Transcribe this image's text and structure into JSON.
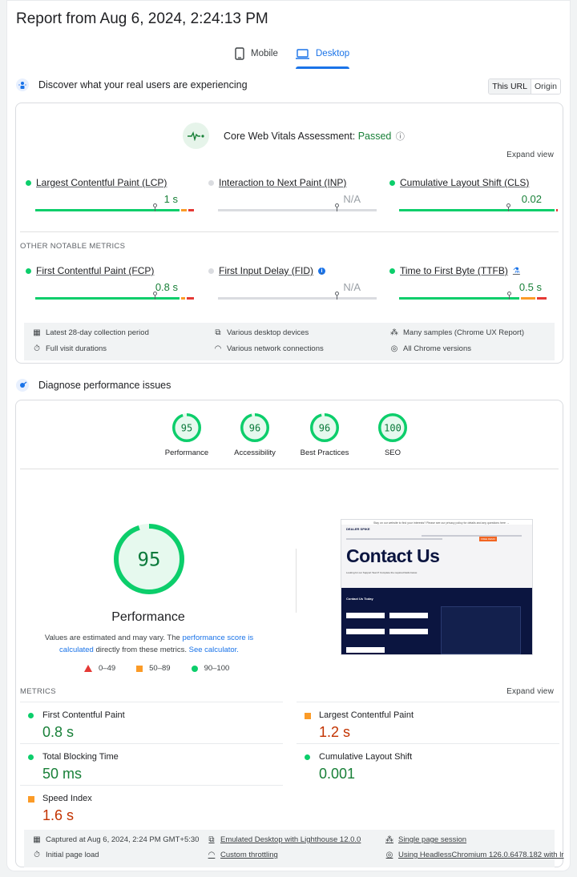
{
  "report_title": "Report from Aug 6, 2024, 2:24:13 PM",
  "tabs": [
    {
      "label": "Mobile"
    },
    {
      "label": "Desktop"
    }
  ],
  "real_users": {
    "heading": "Discover what your real users are experiencing",
    "toggle": [
      "This URL",
      "Origin"
    ],
    "assessment_label": "Core Web Vitals Assessment:",
    "assessment_status": "Passed",
    "expand_view": "Expand view",
    "core_metrics": [
      {
        "name": "Largest Contentful Paint (LCP)",
        "value": "1 s",
        "status": "good"
      },
      {
        "name": "Interaction to Next Paint (INP)",
        "value": "N/A",
        "status": "none"
      },
      {
        "name": "Cumulative Layout Shift (CLS)",
        "value": "0.02",
        "status": "good"
      }
    ],
    "other_title": "OTHER NOTABLE METRICS",
    "other_metrics": [
      {
        "name": "First Contentful Paint (FCP)",
        "value": "0.8 s",
        "status": "good"
      },
      {
        "name": "First Input Delay (FID)",
        "value": "N/A",
        "status": "none"
      },
      {
        "name": "Time to First Byte (TTFB)",
        "value": "0.5 s",
        "status": "good"
      }
    ],
    "footer": [
      {
        "icon": "calendar-icon",
        "text": "Latest 28-day collection period"
      },
      {
        "icon": "devices-icon",
        "text": "Various desktop devices"
      },
      {
        "icon": "samples-icon",
        "text": "Many samples (Chrome UX Report)"
      },
      {
        "icon": "timer-icon",
        "text": "Full visit durations"
      },
      {
        "icon": "wifi-icon",
        "text": "Various network connections"
      },
      {
        "icon": "chrome-icon",
        "text": "All Chrome versions"
      }
    ]
  },
  "diagnose": {
    "heading": "Diagnose performance issues",
    "scores": [
      {
        "label": "Performance",
        "score": "95",
        "fraction": 0.95
      },
      {
        "label": "Accessibility",
        "score": "96",
        "fraction": 0.96
      },
      {
        "label": "Best Practices",
        "score": "96",
        "fraction": 0.96
      },
      {
        "label": "SEO",
        "score": "100",
        "fraction": 1.0
      }
    ],
    "big_score": "95",
    "big_fraction": 0.95,
    "big_label": "Performance",
    "note_prefix": "Values are estimated and may vary. The ",
    "note_link1": "performance score is calculated",
    "note_mid": " directly from these metrics. ",
    "note_link2": "See calculator.",
    "legend": [
      "0–49",
      "50–89",
      "90–100"
    ],
    "screenshot": {
      "banner": "Stay on our website to find your interests? Please see our privacy policy for details and any questions here →",
      "brand": "DEALER SPIKE",
      "heading": "Contact Us",
      "subtext": "Looking for our Support Team? Complete the required fields below.",
      "section": "Contact Us Today",
      "cta": "FREE DEMO"
    },
    "metrics_title": "METRICS",
    "expand_view": "Expand view",
    "metrics": [
      {
        "name": "First Contentful Paint",
        "value": "0.8 s",
        "status": "good"
      },
      {
        "name": "Largest Contentful Paint",
        "value": "1.2 s",
        "status": "average"
      },
      {
        "name": "Total Blocking Time",
        "value": "50 ms",
        "status": "good"
      },
      {
        "name": "Cumulative Layout Shift",
        "value": "0.001",
        "status": "good"
      },
      {
        "name": "Speed Index",
        "value": "1.6 s",
        "status": "average"
      }
    ],
    "footer": [
      {
        "icon": "calendar-icon",
        "text": "Captured at Aug 6, 2024, 2:24 PM GMT+5:30"
      },
      {
        "icon": "devices-icon",
        "text": "Emulated Desktop with Lighthouse 12.0.0"
      },
      {
        "icon": "samples-icon",
        "text": "Single page session"
      },
      {
        "icon": "timer-icon",
        "text": "Initial page load"
      },
      {
        "icon": "wifi-icon",
        "text": "Custom throttling"
      },
      {
        "icon": "chrome-icon",
        "text": "Using HeadlessChromium 126.0.6478.182 with lr"
      }
    ]
  },
  "colors": {
    "good": "#0cce6b",
    "average": "#fb9b27",
    "poor": "#e53935",
    "link": "#1a73e8"
  }
}
